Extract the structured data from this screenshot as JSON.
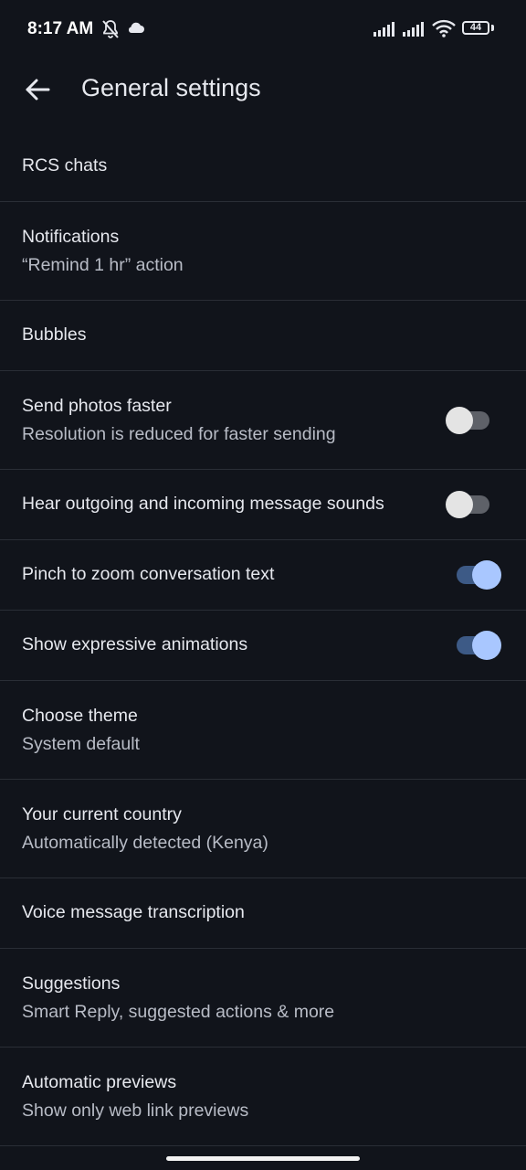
{
  "status_bar": {
    "time": "8:17 AM",
    "battery_level": "44",
    "icons": [
      "bell-off-icon",
      "cloud-icon",
      "signal-icon",
      "signal-icon",
      "wifi-icon",
      "battery-icon"
    ]
  },
  "app_bar": {
    "back_icon": "arrow-left-icon",
    "title": "General settings"
  },
  "settings": [
    {
      "title": "RCS chats"
    },
    {
      "title": "Notifications",
      "subtitle": "“Remind 1 hr” action"
    },
    {
      "title": "Bubbles"
    },
    {
      "title": "Send photos faster",
      "subtitle": "Resolution is reduced for faster sending",
      "toggle": false
    },
    {
      "title": "Hear outgoing and incoming message sounds",
      "toggle": false
    },
    {
      "title": "Pinch to zoom conversation text",
      "toggle": true
    },
    {
      "title": "Show expressive animations",
      "toggle": true
    },
    {
      "title": "Choose theme",
      "subtitle": "System default"
    },
    {
      "title": "Your current country",
      "subtitle": "Automatically detected (Kenya)"
    },
    {
      "title": "Voice message transcription"
    },
    {
      "title": "Suggestions",
      "subtitle": "Smart Reply, suggested actions & more"
    },
    {
      "title": "Automatic previews",
      "subtitle": "Show only web link previews"
    }
  ],
  "colors": {
    "background": "#11141b",
    "divider": "#2a2e36",
    "toggle_on_track": "#3d5a86",
    "toggle_on_thumb": "#a9c7ff",
    "toggle_off_track": "#5e6168",
    "toggle_off_thumb": "#e4e4e4"
  }
}
